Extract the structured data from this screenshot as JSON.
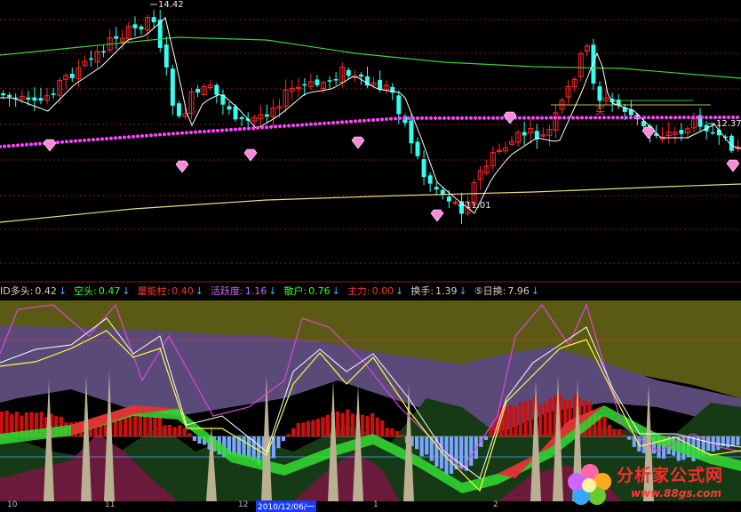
{
  "chart_data": [
    {
      "type": "candlestick",
      "panel": "main",
      "price_labels": [
        "14.42",
        "12.37",
        "11.01"
      ],
      "ylim": [
        10.4,
        14.6
      ],
      "annotations": [
        "14.42",
        "12.37",
        "11.01"
      ],
      "marker_label": "买",
      "colors": {
        "up": "#ff2a2a",
        "down": "#33ffee",
        "ma_long_green": "#3ad23a",
        "ma_white": "#ffffff",
        "ma_yellow": "#e8e080",
        "dots": "#ff44ff",
        "grid": "#8b1a1a"
      }
    },
    {
      "type": "line",
      "panel": "indicator",
      "legend": [
        {
          "label": "ID多头:",
          "value": "0.42",
          "color": "#d0d0d0"
        },
        {
          "label": "空头:",
          "value": "0.47",
          "color": "#33ff33"
        },
        {
          "label": "量能柱:",
          "value": "0.40",
          "color": "#ff3333"
        },
        {
          "label": "活跃度:",
          "value": "1.16",
          "color": "#cc66ff"
        },
        {
          "label": "散户:",
          "value": "0.76",
          "color": "#33ff33"
        },
        {
          "label": "主力:",
          "value": "0.00",
          "color": "#ff3333"
        },
        {
          "label": "换手:",
          "value": "1.39",
          "color": "#d0d0d0"
        },
        {
          "label": "⑤日换:",
          "value": "7.96",
          "color": "#d0d0d0"
        }
      ],
      "arrow_glyph": "↓",
      "series": [
        {
          "name": "多头",
          "color": "#ffffff"
        },
        {
          "name": "空头",
          "color": "#ffff33"
        },
        {
          "name": "活跃度",
          "color": "#dd44dd"
        },
        {
          "name": "量能柱",
          "color": "#cc1010"
        },
        {
          "name": "散户",
          "color": "#33dd33"
        },
        {
          "name": "主力",
          "color": "#dd3333"
        }
      ]
    }
  ],
  "date_axis": {
    "ticks": [
      "10",
      "11",
      "12",
      "1",
      "2"
    ],
    "highlight": "2010/12/06/一"
  },
  "logo": {
    "name": "分析家公式网",
    "url": "www.88gs.com"
  }
}
